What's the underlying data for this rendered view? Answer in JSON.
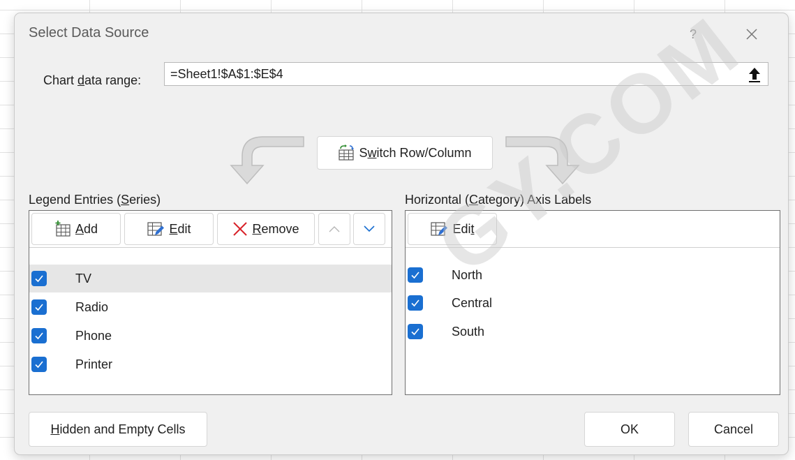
{
  "dialog": {
    "title": "Select Data Source",
    "help_glyph": "?",
    "close_glyph": "✕"
  },
  "range": {
    "label_pre": "Chart ",
    "label_key": "d",
    "label_post": "ata range:",
    "value": "=Sheet1!$A$1:$E$4"
  },
  "switch": {
    "pre": "S",
    "key": "w",
    "post": "itch Row/Column"
  },
  "legend": {
    "label_pre": "Legend Entries (",
    "label_key": "S",
    "label_post": "eries)",
    "add_key": "A",
    "add_rest": "dd",
    "edit_key": "E",
    "edit_rest": "dit",
    "remove_key": "R",
    "remove_rest": "emove",
    "items": [
      {
        "label": "TV",
        "checked": true,
        "selected": true
      },
      {
        "label": "Radio",
        "checked": true,
        "selected": false
      },
      {
        "label": "Phone",
        "checked": true,
        "selected": false
      },
      {
        "label": "Printer",
        "checked": true,
        "selected": false
      }
    ]
  },
  "axis": {
    "label_pre": "Horizontal (",
    "label_key": "C",
    "label_post": "ategory) Axis Labels",
    "edit_pre": "Edi",
    "edit_key": "t",
    "items": [
      {
        "label": "North",
        "checked": true
      },
      {
        "label": "Central",
        "checked": true
      },
      {
        "label": "South",
        "checked": true
      }
    ]
  },
  "footer": {
    "hidden_key": "H",
    "hidden_rest": "idden and Empty Cells",
    "ok": "OK",
    "cancel": "Cancel"
  },
  "watermark": "GY.COM",
  "colors": {
    "accent": "#1a6fd1",
    "dialog_bg": "#f0f0f0",
    "selected_row": "#e6e6e6"
  }
}
